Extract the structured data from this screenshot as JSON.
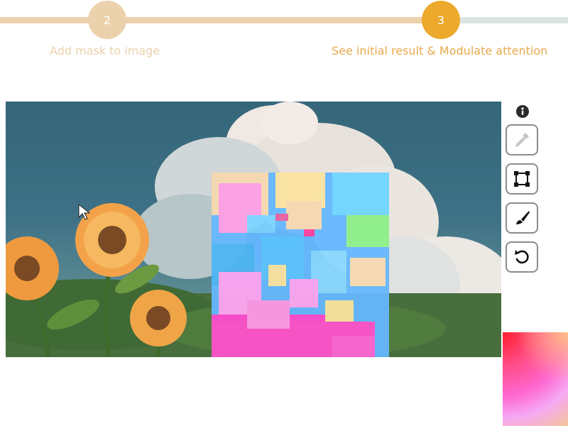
{
  "stepper": {
    "steps": [
      {
        "number": "2",
        "label": "Add mask to image",
        "state": "completed"
      },
      {
        "number": "3",
        "label": "See initial result & Modulate attention",
        "state": "active"
      }
    ],
    "colors": {
      "completed": "#ecd2ac",
      "active": "#eca92c",
      "pending": "#dde4e4"
    }
  },
  "image": {
    "content": "sunflowers-with-clouds",
    "overlay": "segmentation-mask"
  },
  "toolbar": {
    "tools": [
      {
        "icon": "info-icon"
      },
      {
        "icon": "eyedropper-icon"
      },
      {
        "icon": "bounding-box-icon"
      },
      {
        "icon": "brush-icon"
      },
      {
        "icon": "undo-icon"
      }
    ]
  },
  "palette": {
    "colors": [
      "#ff1e2c",
      "#ff4d88",
      "#ff66d0",
      "#f6a8f4",
      "#f4c49a"
    ]
  }
}
